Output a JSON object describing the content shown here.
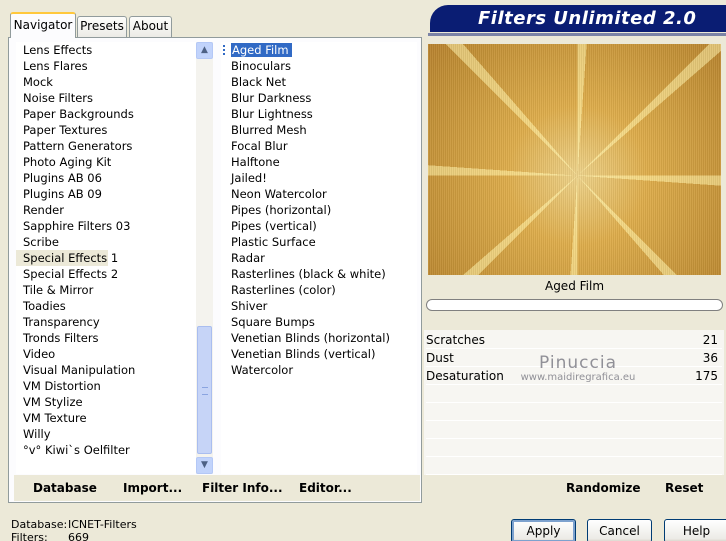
{
  "tabs": [
    {
      "label": "Navigator"
    },
    {
      "label": "Presets"
    },
    {
      "label": "About"
    }
  ],
  "banner": {
    "title": "Filters Unlimited 2.0"
  },
  "categories": [
    "Lens Effects",
    "Lens Flares",
    "Mock",
    "Noise Filters",
    "Paper Backgrounds",
    "Paper Textures",
    "Pattern Generators",
    "Photo Aging Kit",
    "Plugins AB 06",
    "Plugins AB 09",
    "Render",
    "Sapphire Filters 03",
    "Scribe",
    "Special Effects 1",
    "Special Effects 2",
    "Tile & Mirror",
    "Toadies",
    "Transparency",
    "Tronds Filters",
    "Video",
    "Visual Manipulation",
    "VM Distortion",
    "VM Stylize",
    "VM Texture",
    "Willy",
    "°v° Kiwi`s Oelfilter"
  ],
  "selected_category": "Special Effects 1",
  "filters": [
    "Aged Film",
    "Binoculars",
    "Black Net",
    "Blur Darkness",
    "Blur Lightness",
    "Blurred Mesh",
    "Focal Blur",
    "Halftone",
    "Jailed!",
    "Neon Watercolor",
    "Pipes (horizontal)",
    "Pipes (vertical)",
    "Plastic Surface",
    "Radar",
    "Rasterlines (black & white)",
    "Rasterlines (color)",
    "Shiver",
    "Square Bumps",
    "Venetian Blinds (horizontal)",
    "Venetian Blinds (vertical)",
    "Watercolor"
  ],
  "selected_filter": "Aged Film",
  "left_buttons": {
    "database": "Database",
    "import": "Import...",
    "filter_info": "Filter Info...",
    "editor": "Editor..."
  },
  "preview": {
    "filter_name": "Aged Film"
  },
  "params": [
    {
      "label": "Scratches",
      "value": "21"
    },
    {
      "label": "Dust",
      "value": "36"
    },
    {
      "label": "Desaturation",
      "value": "175"
    }
  ],
  "watermark": {
    "name": "Pinuccia",
    "url": "www.maidiregrafica.eu"
  },
  "right_buttons": {
    "randomize": "Randomize",
    "reset": "Reset"
  },
  "status": {
    "database_label": "Database:",
    "database_value": "ICNET-Filters",
    "filters_label": "Filters:",
    "filters_value": "669"
  },
  "dialog_buttons": {
    "apply": "Apply",
    "cancel": "Cancel",
    "help": "Help"
  },
  "colors": {
    "banner": "#0a1d73",
    "selection": "#316ac5",
    "dialog_bg": "#ece9d8"
  }
}
